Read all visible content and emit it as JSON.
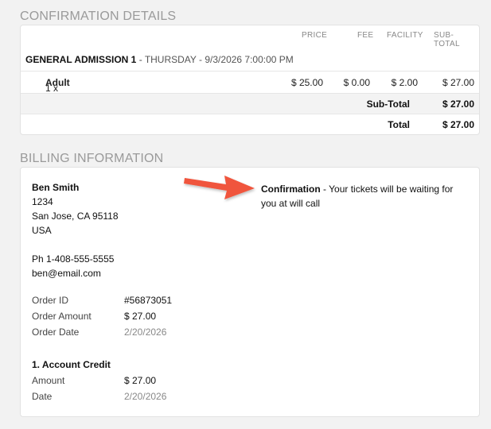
{
  "confirmation": {
    "section_title": "CONFIRMATION DETAILS",
    "columns": {
      "price": "PRICE",
      "fee": "FEE",
      "facility": "FACILITY",
      "subtotal": "SUB-TOTAL"
    },
    "event": {
      "name": "GENERAL ADMISSION 1",
      "separator": " - ",
      "date": "THURSDAY - 9/3/2026 7:00:00 PM"
    },
    "item": {
      "qty": "1 x ",
      "type": "Adult",
      "price": "$ 25.00",
      "fee": "$ 0.00",
      "facility": "$ 2.00",
      "subtotal": "$ 27.00"
    },
    "subtotal_label": "Sub-Total",
    "subtotal_value": "$ 27.00",
    "total_label": "Total",
    "total_value": "$ 27.00"
  },
  "billing": {
    "section_title": "BILLING INFORMATION",
    "name": "Ben Smith",
    "address1": "1234",
    "address2": "San Jose, CA 95118",
    "country": "USA",
    "phone": "Ph 1-408-555-5555",
    "email": "ben@email.com",
    "order_id_label": "Order ID",
    "order_id": "#56873051",
    "order_amount_label": "Order Amount",
    "order_amount": "$ 27.00",
    "order_date_label": "Order Date",
    "order_date": "2/20/2026",
    "payment_title": "1. Account Credit",
    "amount_label": "Amount",
    "amount": "$ 27.00",
    "date_label": "Date",
    "date": "2/20/2026",
    "confirmation_label": "Confirmation",
    "confirmation_text": " - Your tickets will be waiting for you at will call"
  },
  "colors": {
    "arrow": "#f0543c"
  },
  "icons": {
    "annotation": "arrow-icon"
  }
}
